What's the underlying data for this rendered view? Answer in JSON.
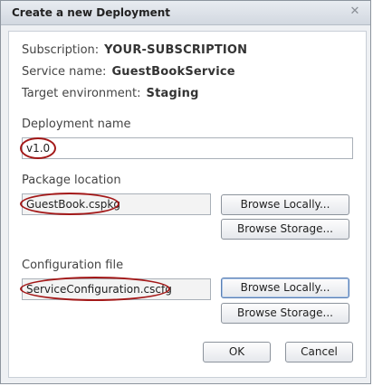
{
  "dialog": {
    "title": "Create a new Deployment",
    "close_glyph": "✕"
  },
  "info": {
    "subscription_label": "Subscription:",
    "subscription_value": "YOUR-SUBSCRIPTION",
    "service_label": "Service name:",
    "service_value": "GuestBookService",
    "env_label": "Target environment:",
    "env_value": "Staging"
  },
  "deployment": {
    "label": "Deployment name",
    "value": "v1.0"
  },
  "package": {
    "label": "Package location",
    "value": "GuestBook.cspkg",
    "browse_local": "Browse Locally...",
    "browse_storage": "Browse Storage..."
  },
  "config": {
    "label": "Configuration file",
    "value": "ServiceConfiguration.cscfg",
    "browse_local": "Browse Locally...",
    "browse_storage": "Browse Storage..."
  },
  "actions": {
    "ok": "OK",
    "cancel": "Cancel"
  },
  "colors": {
    "highlight_circle": "#a31818",
    "focus_border": "#5a7fb3"
  }
}
